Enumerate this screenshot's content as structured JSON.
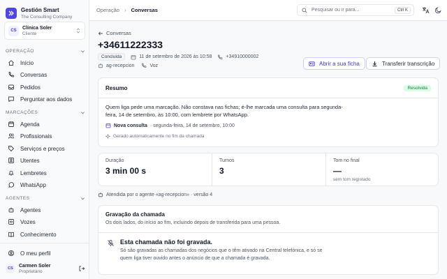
{
  "brand": {
    "name": "Gestión Smart",
    "subtitle": "The Consulting Company"
  },
  "org": {
    "initials": "CS",
    "name": "Clínica Soler",
    "role": "Cliente"
  },
  "sidebar": {
    "sections": [
      {
        "title": "OPERAÇÃO",
        "items": [
          {
            "label": "Início",
            "icon": "home-icon"
          },
          {
            "label": "Conversas",
            "icon": "phone-icon"
          },
          {
            "label": "Pedidos",
            "icon": "inbox-icon"
          },
          {
            "label": "Perguntar aos dados",
            "icon": "chat-icon"
          }
        ]
      },
      {
        "title": "MARCAÇÕES",
        "items": [
          {
            "label": "Agenda",
            "icon": "calendar-icon"
          },
          {
            "label": "Profissionais",
            "icon": "users-icon"
          },
          {
            "label": "Serviços e preços",
            "icon": "tag-icon"
          },
          {
            "label": "Utentes",
            "icon": "contacts-icon"
          },
          {
            "label": "Lembretes",
            "icon": "bell-icon"
          },
          {
            "label": "WhatsApp",
            "icon": "whatsapp-icon"
          }
        ]
      },
      {
        "title": "AGENTES",
        "items": [
          {
            "label": "Agentes",
            "icon": "bot-icon"
          },
          {
            "label": "Vozes",
            "icon": "voice-icon"
          },
          {
            "label": "Conhecimento",
            "icon": "book-icon"
          }
        ]
      }
    ],
    "profile_label": "O meu perfil"
  },
  "user": {
    "initials": "CS",
    "name": "Carmen Soler",
    "role": "Proprietário"
  },
  "breadcrumb": {
    "parent": "Operação",
    "separator": "›",
    "current": "Conversas"
  },
  "search": {
    "placeholder": "Pesquisar ou ir para...",
    "shortcut": "Ctrl K"
  },
  "call": {
    "back_label": "Conversas",
    "phone": "+34611222333",
    "status": "Concluída",
    "datetime": "11 de setembro de 2026 às 10:58",
    "to_number": "+34910000002",
    "agent": "ag-recepcion",
    "channel": "Voz",
    "open_record_label": "Abrir a sua ficha",
    "download_label": "Transferir transcrição"
  },
  "summary": {
    "title": "Resumo",
    "badge": "Resolvida",
    "text": "Quem liga pede uma marcação. Não constava nas fichas; é-lhe marcada uma consulta para segunda-feira, 14 de setembro, às 10:00, com lembrete por WhatsApp.",
    "appointment_label": "Nova consulta",
    "appointment_detail": "· segunda-feira, 14 de setembro, 10:00",
    "generated_note": "Gerado automaticamente no fim da chamada"
  },
  "stats": [
    {
      "label": "Duração",
      "value": "3 min 00 s",
      "sub": ""
    },
    {
      "label": "Turnos",
      "value": "3",
      "sub": ""
    },
    {
      "label": "Tom no final",
      "value": "—",
      "sub": "sem tom registado"
    }
  ],
  "attended_by": "Atendida por o agente «ag-recepcion» · versão 4",
  "recording": {
    "title": "Gravação da chamada",
    "description": "Os dois lados, do início ao fim, incluindo depois de transferida para uma pessoa.",
    "empty_title": "Esta chamada não foi gravada.",
    "empty_text": "Só são gravadas as chamadas dos negócios que o têm ativado na Central telefónica, e só se quem liga tiver ouvido antes o anúncio de que a chamada é gravada."
  },
  "colors": {
    "accent": "#4f46e5",
    "success_bg": "#dcfce7",
    "success_text": "#15803d"
  }
}
